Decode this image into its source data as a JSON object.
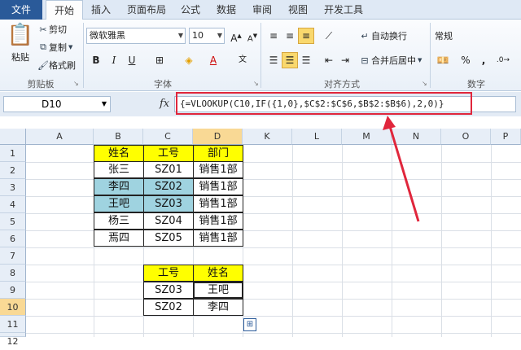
{
  "tabs": [
    "文件",
    "开始",
    "插入",
    "页面布局",
    "公式",
    "数据",
    "审阅",
    "视图",
    "开发工具"
  ],
  "clipboard": {
    "paste": "粘贴",
    "cut": "剪切",
    "copy": "复制",
    "format_painter": "格式刷",
    "group": "剪贴板"
  },
  "font": {
    "name": "微软雅黑",
    "size": "10",
    "bold": "B",
    "italic": "I",
    "underline": "U",
    "group": "字体"
  },
  "alignment": {
    "wrap": "自动换行",
    "merge": "合并后居中",
    "group": "对齐方式"
  },
  "number": {
    "format": "常规",
    "percent": "%",
    "comma": ",",
    "group": "数字"
  },
  "formula_bar": {
    "name_box": "D10",
    "fx": "fx",
    "formula": "{=VLOOKUP(C10,IF({1,0},$C$2:$C$6,$B$2:$B$6),2,0)}"
  },
  "columns": [
    "A",
    "B",
    "C",
    "D",
    "K",
    "L",
    "M",
    "N",
    "O",
    "P"
  ],
  "rows": [
    "1",
    "2",
    "3",
    "4",
    "5",
    "6",
    "7",
    "8",
    "9",
    "10",
    "11",
    "12"
  ],
  "table1": {
    "headers": [
      "姓名",
      "工号",
      "部门"
    ],
    "rows": [
      [
        "张三",
        "SZ01",
        "销售1部"
      ],
      [
        "李四",
        "SZ02",
        "销售1部"
      ],
      [
        "王吧",
        "SZ03",
        "销售1部"
      ],
      [
        "杨三",
        "SZ04",
        "销售1部"
      ],
      [
        "焉四",
        "SZ05",
        "销售1部"
      ]
    ]
  },
  "table2": {
    "headers": [
      "工号",
      "姓名"
    ],
    "rows": [
      [
        "SZ03",
        "王吧"
      ],
      [
        "SZ02",
        "李四"
      ]
    ]
  },
  "colors": {
    "highlight_yellow": "#ffff00",
    "highlight_blue": "#9fd3e0",
    "annotation_red": "#e0263c"
  }
}
